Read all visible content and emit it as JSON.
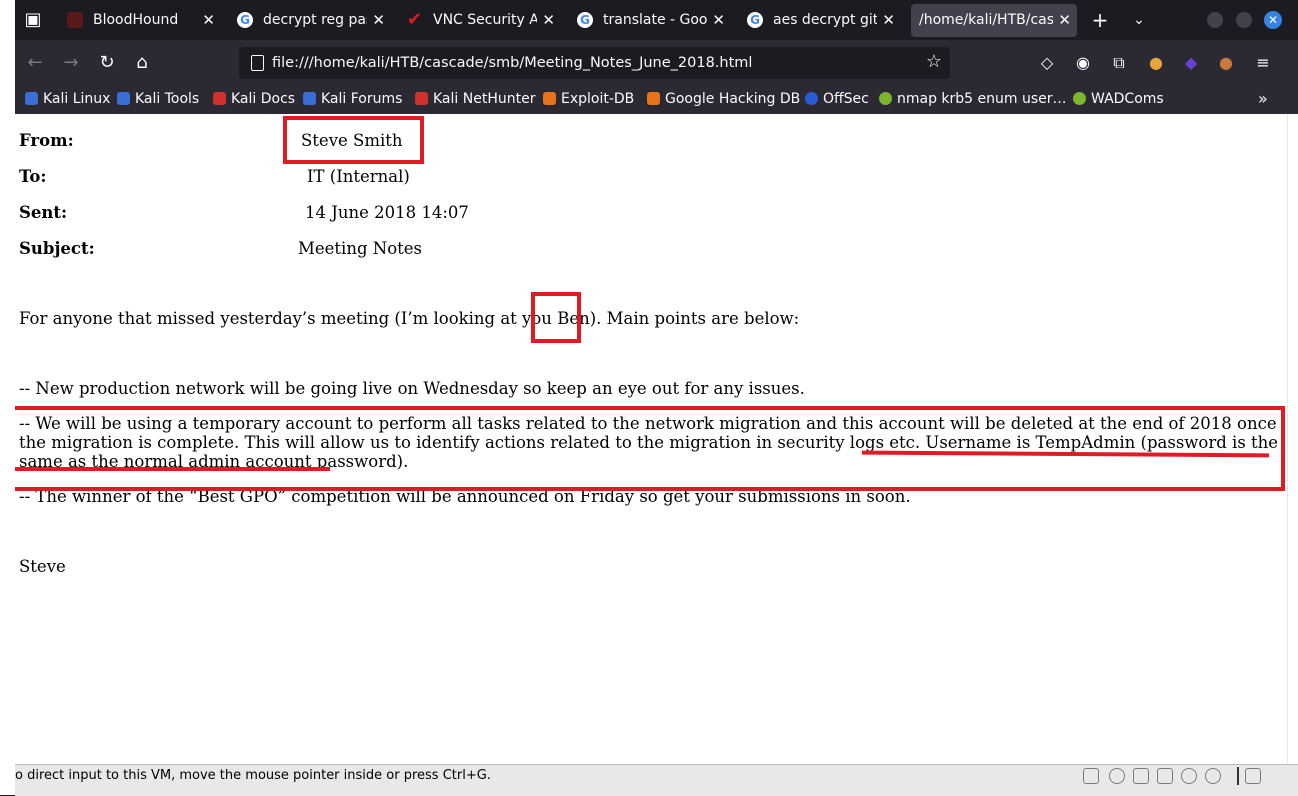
{
  "tabs": [
    {
      "label": "BloodHound",
      "icon": "bloodhound-icon"
    },
    {
      "label": "decrypt reg passw",
      "icon": "google-icon"
    },
    {
      "label": "VNC Security Aud",
      "icon": "checkmark-icon"
    },
    {
      "label": "translate - Google",
      "icon": "google-icon"
    },
    {
      "label": "aes decrypt github",
      "icon": "google-icon"
    },
    {
      "label": "/home/kali/HTB/cascade",
      "icon": ""
    }
  ],
  "nav": {
    "url": "file:///home/kali/HTB/cascade/smb/Meeting_Notes_June_2018.html"
  },
  "bookmarks": [
    {
      "label": "Kali Linux",
      "color": "#3a6fd8"
    },
    {
      "label": "Kali Tools",
      "color": "#3a6fd8"
    },
    {
      "label": "Kali Docs",
      "color": "#d0312d"
    },
    {
      "label": "Kali Forums",
      "color": "#3a6fd8"
    },
    {
      "label": "Kali NetHunter",
      "color": "#d0312d"
    },
    {
      "label": "Exploit-DB",
      "color": "#e8731a"
    },
    {
      "label": "Google Hacking DB",
      "color": "#e8731a"
    },
    {
      "label": "OffSec",
      "color": "#2a5bd7"
    },
    {
      "label": "nmap krb5 enum user…",
      "color": "#7bb62d"
    },
    {
      "label": "WADComs",
      "color": "#7bb62d"
    }
  ],
  "email": {
    "from_label": "From:",
    "from_value": "Steve Smith",
    "to_label": "To:",
    "to_value": "IT (Internal)",
    "sent_label": "Sent:",
    "sent_value": "14 June 2018 14:07",
    "subject_label": "Subject:",
    "subject_value": "Meeting Notes",
    "intro_before": "For anyone that missed yesterday’s meeting (I’m looking at you ",
    "intro_name": "Ben",
    "intro_after": "). Main points are below:",
    "point1": "-- New production network will be going live on Wednesday so keep an eye out for any issues.",
    "point2_part1": "-- We will be using a temporary account to perform all tasks related to the network migration and this account will be deleted at the end of 2018 once the migration is complete. This will allow us to identify actions related to the migration in security logs etc.",
    "point2_part2": " Username is TempAdmin (password is the same as the normal admin account password).",
    "point3": "-- The winner of the “Best GPO” competition will be announced on Friday so get your submissions in soon.",
    "signature": "Steve"
  },
  "statusbar": {
    "text": "o direct input to this VM, move the mouse pointer inside or press Ctrl+G."
  },
  "colors": {
    "accent_red": "#e01b24",
    "firefox_dark": "#1c1b22",
    "toolbar": "#2b2a33"
  }
}
